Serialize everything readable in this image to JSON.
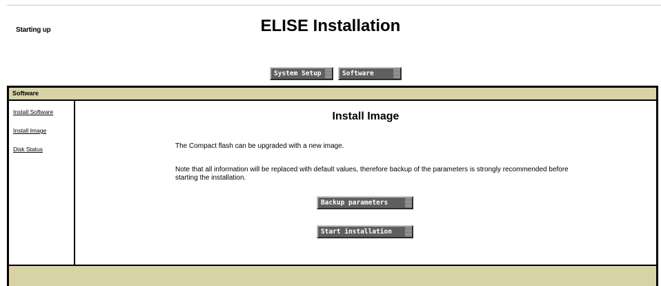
{
  "header": {
    "status": "Starting up",
    "title": "ELISE Installation"
  },
  "topnav": {
    "items": [
      {
        "label": "System Setup"
      },
      {
        "label": "Software"
      }
    ]
  },
  "section": {
    "title": "Software"
  },
  "sidebar": {
    "items": [
      {
        "label": "Install Software"
      },
      {
        "label": "Install Image"
      },
      {
        "label": "Disk Status"
      }
    ]
  },
  "main": {
    "heading": "Install Image",
    "paragraph1": "The Compact flash can be upgraded with a new image.",
    "paragraph2": "Note that all information will be replaced with default values, therefore backup of the parameters is strongly recommended before starting the installation.",
    "buttons": {
      "backup": "Backup parameters",
      "start": "Start installation"
    }
  },
  "colors": {
    "header_band": "#d8d3a6",
    "button_face": "#5f5f5f",
    "border": "#000000"
  }
}
